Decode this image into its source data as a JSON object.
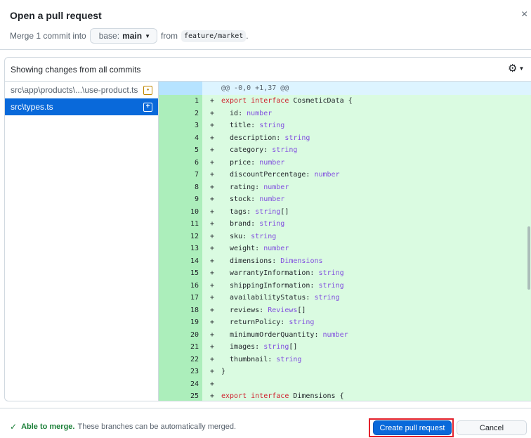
{
  "dialog": {
    "title": "Open a pull request",
    "close_icon": "×",
    "merge_prefix": "Merge 1 commit into",
    "base_key": "base:",
    "base_value": "main",
    "from_label": "from",
    "compare_branch": "feature/market",
    "period": "."
  },
  "diff_panel": {
    "header_label": "Showing changes from all commits",
    "settings_icon": "gear-icon",
    "files": [
      {
        "name": "src\\app\\products\\...\\use-product.ts",
        "status": "modified"
      },
      {
        "name": "src\\types.ts",
        "status": "added",
        "selected": true
      }
    ],
    "hunk_header": "@@ -0,0 +1,37 @@",
    "lines": [
      {
        "n": "1",
        "code": "export interface CosmeticData {"
      },
      {
        "n": "2",
        "code": "  id: number"
      },
      {
        "n": "3",
        "code": "  title: string"
      },
      {
        "n": "4",
        "code": "  description: string"
      },
      {
        "n": "5",
        "code": "  category: string"
      },
      {
        "n": "6",
        "code": "  price: number"
      },
      {
        "n": "7",
        "code": "  discountPercentage: number"
      },
      {
        "n": "8",
        "code": "  rating: number"
      },
      {
        "n": "9",
        "code": "  stock: number"
      },
      {
        "n": "10",
        "code": "  tags: string[]"
      },
      {
        "n": "11",
        "code": "  brand: string"
      },
      {
        "n": "12",
        "code": "  sku: string"
      },
      {
        "n": "13",
        "code": "  weight: number"
      },
      {
        "n": "14",
        "code": "  dimensions: Dimensions"
      },
      {
        "n": "15",
        "code": "  warrantyInformation: string"
      },
      {
        "n": "16",
        "code": "  shippingInformation: string"
      },
      {
        "n": "17",
        "code": "  availabilityStatus: string"
      },
      {
        "n": "18",
        "code": "  reviews: Reviews[]"
      },
      {
        "n": "19",
        "code": "  returnPolicy: string"
      },
      {
        "n": "20",
        "code": "  minimumOrderQuantity: number"
      },
      {
        "n": "21",
        "code": "  images: string[]"
      },
      {
        "n": "22",
        "code": "  thumbnail: string"
      },
      {
        "n": "23",
        "code": "}"
      },
      {
        "n": "24",
        "code": ""
      },
      {
        "n": "25",
        "code": "export interface Dimensions {"
      }
    ]
  },
  "footer": {
    "check_icon": "✓",
    "merge_ok": "Able to merge.",
    "merge_msg": "These branches can be automatically merged.",
    "create_label": "Create pull request",
    "cancel_label": "Cancel"
  },
  "colors": {
    "accent": "#0969da",
    "added_line": "#dafbe1",
    "added_gutter": "#aceebb",
    "success": "#1a7f37",
    "highlight_box": "#e3202b"
  }
}
